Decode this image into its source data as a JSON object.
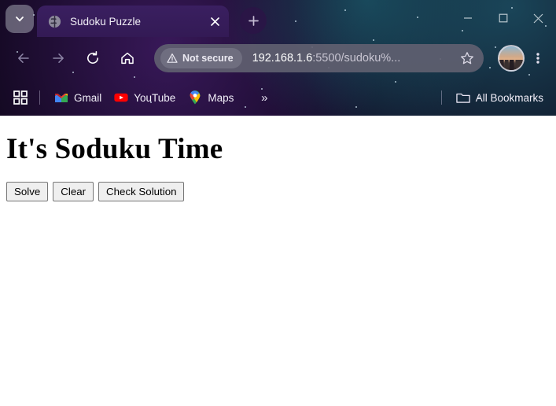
{
  "browser": {
    "tab_search_icon": "chevron-down-icon",
    "tab": {
      "favicon": "globe-icon",
      "title": "Sudoku Puzzle",
      "close_icon": "close-icon"
    },
    "new_tab_icon": "plus-icon",
    "window_controls": {
      "minimize": "minimize-icon",
      "maximize": "maximize-icon",
      "close": "close-icon"
    },
    "toolbar": {
      "back_icon": "back-arrow-icon",
      "forward_icon": "forward-arrow-icon",
      "reload_icon": "reload-icon",
      "home_icon": "home-icon",
      "security_label": "Not secure",
      "security_icon": "warning-triangle-icon",
      "url_host": "192.168.1.6",
      "url_rest": ":5500/sudoku%...",
      "url_full": "192.168.1.6:5500/sudoku%...",
      "bookmark_icon": "star-outline-icon",
      "avatar": "profile-avatar",
      "menu_icon": "three-dot-menu-icon"
    },
    "bookmarks_bar": {
      "apps_icon": "apps-grid-icon",
      "items": [
        {
          "label": "Gmail",
          "icon": "gmail-icon"
        },
        {
          "label": "YouTube",
          "icon": "youtube-icon"
        },
        {
          "label": "Maps",
          "icon": "google-maps-pin-icon"
        }
      ],
      "overflow": "»",
      "all_bookmarks_label": "All Bookmarks",
      "all_bookmarks_icon": "folder-icon"
    }
  },
  "page": {
    "heading": "It's Soduku Time",
    "buttons": [
      {
        "label": "Solve"
      },
      {
        "label": "Clear"
      },
      {
        "label": "Check Solution"
      }
    ]
  },
  "colors": {
    "chrome_purple": "#331a55",
    "omnibox": "#606070",
    "page_bg": "#ffffff",
    "button_bg": "#efefef",
    "button_border": "#767676",
    "youtube_red": "#ff0000"
  }
}
